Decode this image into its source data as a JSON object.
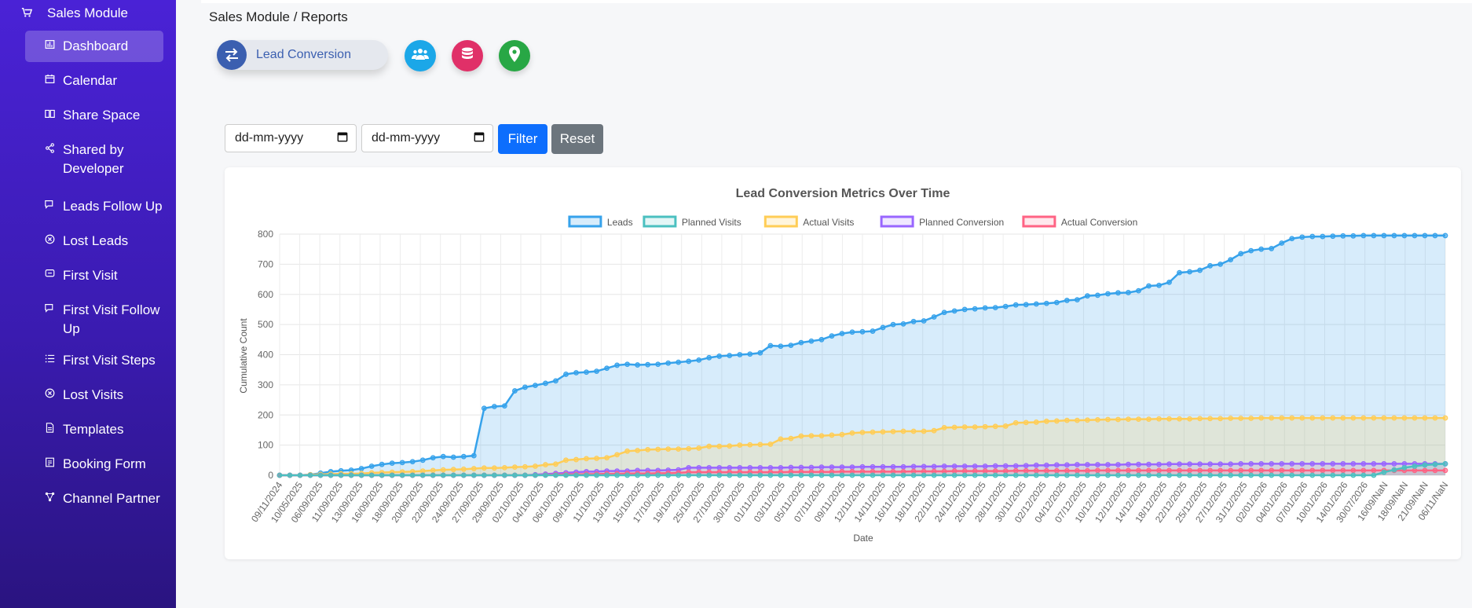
{
  "sidebar": {
    "header": {
      "label": "Sales Module",
      "icon": "cart-icon"
    },
    "items": [
      {
        "label": "Dashboard",
        "icon": "dashboard-icon",
        "active": true
      },
      {
        "label": "Calendar",
        "icon": "calendar-icon"
      },
      {
        "label": "Share Space",
        "icon": "book-icon"
      },
      {
        "label": "Shared by Developer",
        "icon": "share-icon"
      },
      {
        "label": "Leads Follow Up",
        "icon": "chat-icon"
      },
      {
        "label": "Lost Leads",
        "icon": "x-circle-icon"
      },
      {
        "label": "First Visit",
        "icon": "message-icon"
      },
      {
        "label": "First Visit Follow Up",
        "icon": "chat-icon"
      },
      {
        "label": "First Visit Steps",
        "icon": "list-icon"
      },
      {
        "label": "Lost Visits",
        "icon": "x-circle-icon"
      },
      {
        "label": "Templates",
        "icon": "file-icon"
      },
      {
        "label": "Booking Form",
        "icon": "form-icon"
      },
      {
        "label": "Channel Partner",
        "icon": "network-icon"
      }
    ]
  },
  "breadcrumb": "Sales Module / Reports",
  "report_tabs": {
    "active_label": "Lead Conversion",
    "active_icon": "swap-icon",
    "icons": [
      "users-icon",
      "database-icon",
      "map-pin-icon"
    ],
    "colors": {
      "active": "#3b5fb0",
      "users": "#1ba7e8",
      "database": "#e03068",
      "map": "#28a745"
    }
  },
  "filters": {
    "start_date": "dd-mm-yyyy",
    "end_date": "dd-mm-yyyy",
    "filter_label": "Filter",
    "reset_label": "Reset"
  },
  "chart_data": {
    "type": "area",
    "title": "Lead Conversion Metrics Over Time",
    "xlabel": "Date",
    "ylabel": "Cumulative Count",
    "ylim": [
      0,
      800
    ],
    "yticks": [
      0,
      100,
      200,
      300,
      400,
      500,
      600,
      700,
      800
    ],
    "grid": true,
    "legend": "top",
    "x_tick_labels": [
      "09/11/2024",
      "10/05/2025",
      "06/09/2025",
      "11/09/2025",
      "13/09/2025",
      "16/09/2025",
      "18/09/2025",
      "20/09/2025",
      "22/09/2025",
      "24/09/2025",
      "27/09/2025",
      "29/09/2025",
      "02/10/2025",
      "04/10/2025",
      "06/10/2025",
      "09/10/2025",
      "11/10/2025",
      "13/10/2025",
      "15/10/2025",
      "17/10/2025",
      "19/10/2025",
      "25/10/2025",
      "27/10/2025",
      "30/10/2025",
      "01/11/2025",
      "03/11/2025",
      "05/11/2025",
      "07/11/2025",
      "09/11/2025",
      "12/11/2025",
      "14/11/2025",
      "16/11/2025",
      "18/11/2025",
      "22/11/2025",
      "24/11/2025",
      "26/11/2025",
      "28/11/2025",
      "30/11/2025",
      "02/12/2025",
      "04/12/2025",
      "07/12/2025",
      "10/12/2025",
      "12/12/2025",
      "14/12/2025",
      "18/12/2025",
      "22/12/2025",
      "25/12/2025",
      "27/12/2025",
      "31/12/2025",
      "02/01/2026",
      "04/01/2026",
      "07/01/2026",
      "10/01/2026",
      "14/01/2026",
      "30/07/2026",
      "16/09/NaN",
      "18/09/NaN",
      "21/09/NaN",
      "06/11/NaN"
    ],
    "series": [
      {
        "name": "Leads",
        "color": "#36a2eb",
        "fill": "rgba(54,162,235,0.2)",
        "values": [
          0,
          0,
          0,
          2,
          7,
          12,
          15,
          17,
          22,
          30,
          36,
          40,
          42,
          45,
          50,
          58,
          62,
          60,
          62,
          65,
          222,
          228,
          230,
          280,
          292,
          298,
          305,
          313,
          335,
          340,
          342,
          345,
          355,
          365,
          368,
          366,
          367,
          368,
          372,
          375,
          378,
          382,
          390,
          395,
          397,
          400,
          402,
          406,
          430,
          428,
          431,
          440,
          445,
          450,
          462,
          470,
          475,
          476,
          478,
          490,
          500,
          502,
          510,
          512,
          525,
          540,
          545,
          550,
          552,
          555,
          556,
          560,
          565,
          566,
          568,
          570,
          573,
          580,
          582,
          595,
          597,
          602,
          605,
          606,
          612,
          628,
          630,
          640,
          672,
          675,
          680,
          695,
          700,
          715,
          735,
          745,
          750,
          752,
          770,
          785,
          790,
          792,
          792,
          793,
          794,
          794,
          795,
          795,
          795,
          795,
          795,
          795,
          795,
          795,
          795
        ]
      },
      {
        "name": "Planned Visits",
        "color": "#4bc0c0",
        "fill": "rgba(75,192,192,0.15)",
        "values": [
          0,
          0,
          0,
          0,
          0,
          0,
          0,
          0,
          0,
          0,
          0,
          0,
          0,
          0,
          0,
          0,
          0,
          0,
          0,
          0,
          0,
          0,
          0,
          0,
          0,
          0,
          0,
          0,
          0,
          0,
          0,
          0,
          0,
          0,
          0,
          0,
          0,
          0,
          0,
          0,
          0,
          0,
          0,
          0,
          0,
          0,
          0,
          0,
          0,
          0,
          0,
          0,
          0,
          0,
          0,
          0,
          0,
          0,
          0,
          0,
          0,
          0,
          0,
          0,
          0,
          0,
          0,
          0,
          0,
          0,
          0,
          0,
          0,
          0,
          0,
          0,
          0,
          0,
          0,
          0,
          0,
          0,
          0,
          0,
          0,
          0,
          0,
          0,
          0,
          0,
          0,
          0,
          0,
          0,
          0,
          0,
          0,
          0,
          0,
          0,
          0,
          0,
          0,
          0,
          0,
          0,
          0,
          0,
          10,
          18,
          25,
          30,
          34,
          36,
          38
        ]
      },
      {
        "name": "Actual Visits",
        "color": "#ffcd56",
        "fill": "rgba(255,205,86,0.2)",
        "values": [
          0,
          0,
          0,
          2,
          3,
          4,
          5,
          5,
          6,
          8,
          9,
          10,
          11,
          12,
          14,
          16,
          18,
          19,
          20,
          22,
          24,
          24,
          25,
          27,
          28,
          30,
          35,
          37,
          50,
          52,
          55,
          56,
          58,
          68,
          80,
          82,
          85,
          86,
          87,
          87,
          88,
          90,
          96,
          96,
          97,
          100,
          101,
          102,
          103,
          120,
          122,
          130,
          131,
          131,
          133,
          135,
          140,
          142,
          143,
          144,
          145,
          146,
          146,
          146,
          148,
          158,
          159,
          160,
          160,
          161,
          162,
          163,
          174,
          175,
          176,
          179,
          180,
          182,
          182,
          183,
          184,
          185,
          185,
          186,
          186,
          186,
          187,
          187,
          187,
          187,
          188,
          188,
          188,
          189,
          189,
          189,
          190,
          190,
          190,
          190,
          190,
          190,
          190,
          190,
          190,
          190,
          190,
          190,
          190,
          190,
          190,
          190,
          190,
          190,
          190
        ]
      },
      {
        "name": "Planned Conversion",
        "color": "#9966ff",
        "fill": "rgba(153,102,255,0.15)",
        "values": [
          0,
          0,
          0,
          0,
          0,
          0,
          0,
          0,
          0,
          0,
          0,
          0,
          0,
          0,
          0,
          0,
          0,
          0,
          0,
          0,
          0,
          0,
          0,
          0,
          0,
          2,
          4,
          6,
          8,
          10,
          12,
          12,
          14,
          14,
          14,
          16,
          16,
          16,
          17,
          18,
          25,
          25,
          25,
          25,
          25,
          25,
          25,
          25,
          25,
          25,
          26,
          26,
          26,
          27,
          27,
          27,
          27,
          28,
          28,
          28,
          28,
          28,
          29,
          29,
          29,
          30,
          30,
          30,
          30,
          30,
          31,
          31,
          31,
          32,
          33,
          33,
          34,
          34,
          35,
          35,
          35,
          35,
          35,
          36,
          36,
          36,
          36,
          37,
          37,
          37,
          37,
          37,
          37,
          37,
          38,
          38,
          38,
          38,
          38,
          38,
          38,
          38,
          38,
          38,
          38,
          38,
          38,
          38,
          38,
          38,
          38,
          38,
          38,
          38,
          38
        ]
      },
      {
        "name": "Actual Conversion",
        "color": "#ff6384",
        "fill": "rgba(255,99,132,0.15)",
        "values": [
          0,
          0,
          0,
          0,
          0,
          0,
          0,
          0,
          0,
          0,
          0,
          0,
          0,
          0,
          0,
          0,
          0,
          0,
          0,
          0,
          0,
          0,
          0,
          0,
          0,
          0,
          1,
          2,
          3,
          3,
          4,
          4,
          5,
          5,
          6,
          6,
          6,
          7,
          7,
          8,
          10,
          10,
          10,
          10,
          10,
          10,
          10,
          10,
          10,
          10,
          11,
          11,
          11,
          11,
          11,
          12,
          12,
          12,
          12,
          12,
          12,
          12,
          13,
          13,
          13,
          13,
          14,
          14,
          14,
          14,
          14,
          14,
          15,
          15,
          15,
          15,
          15,
          15,
          15,
          15,
          16,
          16,
          16,
          16,
          16,
          16,
          16,
          16,
          16,
          16,
          16,
          16,
          16,
          16,
          16,
          16,
          16,
          16,
          16,
          16,
          16,
          16,
          16,
          16,
          16,
          16,
          16,
          16,
          16,
          16,
          16,
          16,
          16,
          16,
          16
        ]
      }
    ]
  }
}
